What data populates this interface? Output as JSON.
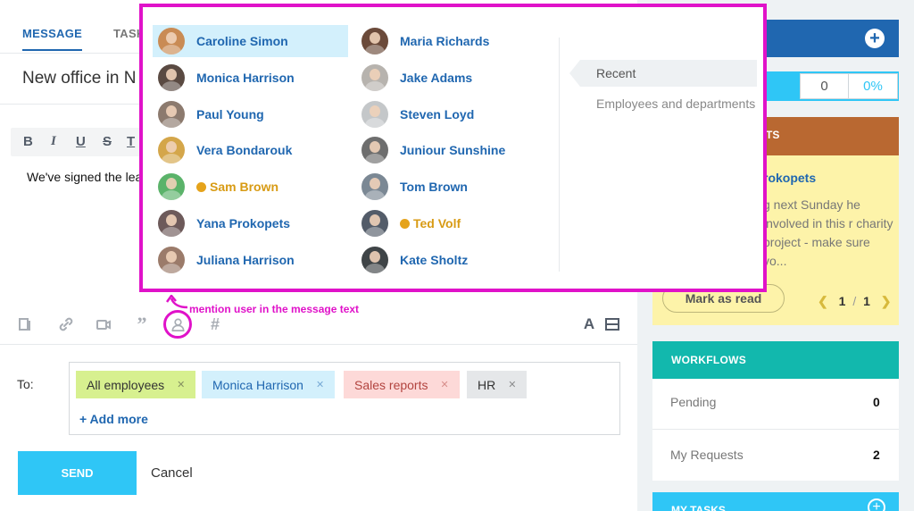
{
  "editor": {
    "tabs": [
      "MESSAGE",
      "TASK"
    ],
    "subject": "New office in N",
    "format_buttons": [
      "B",
      "I",
      "U",
      "S",
      "T"
    ],
    "body_text": "We've signed the lea",
    "to_label": "To:",
    "recipients": [
      {
        "label": "All employees",
        "bg": "#d7f08f",
        "color": "#333"
      },
      {
        "label": "Monica Harrison",
        "bg": "#d3f0fc",
        "color": "#2067b0"
      },
      {
        "label": "Sales reports",
        "bg": "#fdd9d8",
        "color": "#b2443f"
      },
      {
        "label": "HR",
        "bg": "#e5e7e9",
        "color": "#333"
      }
    ],
    "add_more": "+ Add more",
    "send": "SEND",
    "cancel": "Cancel",
    "annotation": "mention user in the message text",
    "toolbar_icons": [
      "file-icon",
      "link-icon",
      "video-icon",
      "quote-icon",
      "mention-icon",
      "hashtag-icon",
      "text-format-icon",
      "panel-icon"
    ]
  },
  "popup": {
    "left_users": [
      {
        "name": "Caroline Simon",
        "selected": true,
        "extranet": false,
        "avatar": "#c98b54"
      },
      {
        "name": "Monica Harrison",
        "selected": false,
        "extranet": false,
        "avatar": "#5a4a42"
      },
      {
        "name": "Paul Young",
        "selected": false,
        "extranet": false,
        "avatar": "#8c7a6e"
      },
      {
        "name": "Vera Bondarouk",
        "selected": false,
        "extranet": false,
        "avatar": "#d4a64a"
      },
      {
        "name": "Sam Brown",
        "selected": false,
        "extranet": true,
        "avatar": "#5bb36a"
      },
      {
        "name": "Yana Prokopets",
        "selected": false,
        "extranet": false,
        "avatar": "#6d5a5a"
      },
      {
        "name": "Juliana Harrison",
        "selected": false,
        "extranet": false,
        "avatar": "#9b7b6a"
      }
    ],
    "right_users": [
      {
        "name": "Maria Richards",
        "selected": false,
        "extranet": false,
        "avatar": "#6b4a3a"
      },
      {
        "name": "Jake Adams",
        "selected": false,
        "extranet": false,
        "avatar": "#b7b3ae"
      },
      {
        "name": "Steven Loyd",
        "selected": false,
        "extranet": false,
        "avatar": "#c4c7c9"
      },
      {
        "name": "Juniour Sunshine",
        "selected": false,
        "extranet": false,
        "avatar": "#6e6e6e"
      },
      {
        "name": "Tom Brown",
        "selected": false,
        "extranet": false,
        "avatar": "#7b8894"
      },
      {
        "name": "Ted Volf",
        "selected": false,
        "extranet": true,
        "avatar": "#535c69"
      },
      {
        "name": "Kate Sholtz",
        "selected": false,
        "extranet": false,
        "avatar": "#3f4447"
      }
    ],
    "recent": "Recent",
    "employees_departments": "Employees and departments"
  },
  "sidebar": {
    "counter_a": "0",
    "counter_b": "0%",
    "announce_title_fragment": "TS",
    "announce_name": "rokopets",
    "announce_text": "g next Sunday he involved in this r charity project - make sure yo...",
    "mark_read": "Mark as read",
    "pager_current": "1",
    "pager_sep": "/",
    "pager_total": "1",
    "workflows": {
      "title": "WORKFLOWS",
      "rows": [
        {
          "label": "Pending",
          "value": "0"
        },
        {
          "label": "My Requests",
          "value": "2"
        }
      ]
    },
    "my_tasks": "MY TASKS"
  }
}
